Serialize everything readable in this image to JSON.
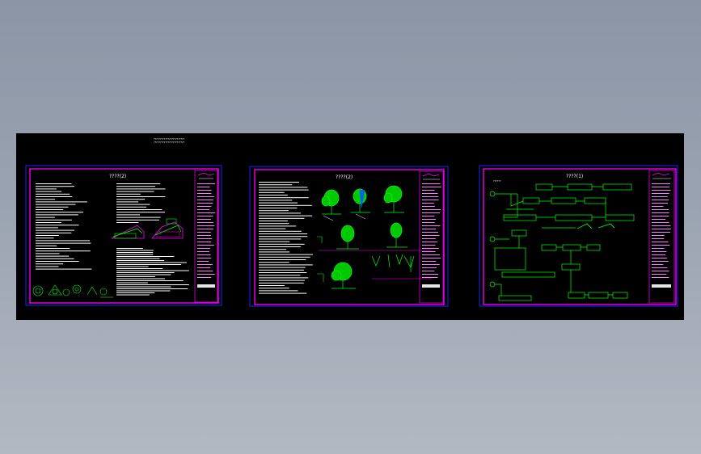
{
  "viewer": {
    "background_color": "#000000",
    "colors": {
      "sheet_border": "#2020ff",
      "frame": "#ff00ff",
      "text": "#ffffff",
      "graphics": "#00ff00",
      "water": "#0060ff"
    }
  },
  "drawing": {
    "header_notes": [
      "????????????????????????",
      "????????????????????????"
    ],
    "sheets": [
      {
        "name": "sheet-1",
        "title": "????(2)"
      },
      {
        "name": "sheet-2",
        "title": "????(2)"
      },
      {
        "name": "sheet-3",
        "title": "????(1)"
      }
    ]
  }
}
